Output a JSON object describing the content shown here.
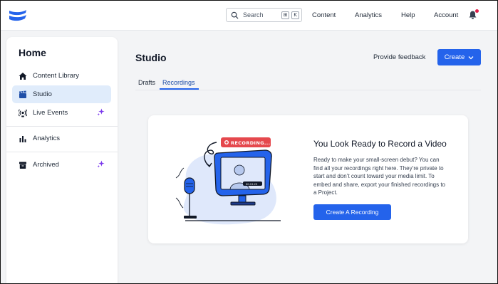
{
  "nav": {
    "search_placeholder": "Search",
    "search_shortcut_mod": "⊞",
    "search_shortcut_key": "K",
    "links": [
      "Content",
      "Analytics",
      "Help",
      "Account"
    ]
  },
  "sidebar": {
    "title": "Home",
    "items": [
      {
        "label": "Content Library",
        "icon": "home-icon"
      },
      {
        "label": "Studio",
        "icon": "clapperboard-icon",
        "active": true
      },
      {
        "label": "Live Events",
        "icon": "broadcast-icon",
        "badge": "sparkle-icon"
      },
      {
        "label": "Analytics",
        "icon": "bar-chart-icon"
      },
      {
        "label": "Archived",
        "icon": "archive-icon",
        "badge": "sparkle-icon"
      }
    ]
  },
  "main": {
    "title": "Studio",
    "feedback_label": "Provide feedback",
    "create_label": "Create",
    "tabs": [
      {
        "label": "Drafts"
      },
      {
        "label": "Recordings",
        "active": true
      }
    ]
  },
  "card": {
    "recording_badge": "RECORDING...",
    "cam_label": "00:15:23",
    "title": "You Look Ready to Record a Video",
    "body": "Ready to make your small-screen debut? You can find all your recordings right here. They’re private to start and don’t count toward your media limit. To embed and share, export your finished recordings to a Project.",
    "button_label": "Create A Recording"
  },
  "colors": {
    "accent": "#2463eb",
    "active_bg": "#e0ecfb",
    "notification": "#e11d48",
    "recording_red": "#e5484d",
    "sparkle": "#7c3aed"
  }
}
